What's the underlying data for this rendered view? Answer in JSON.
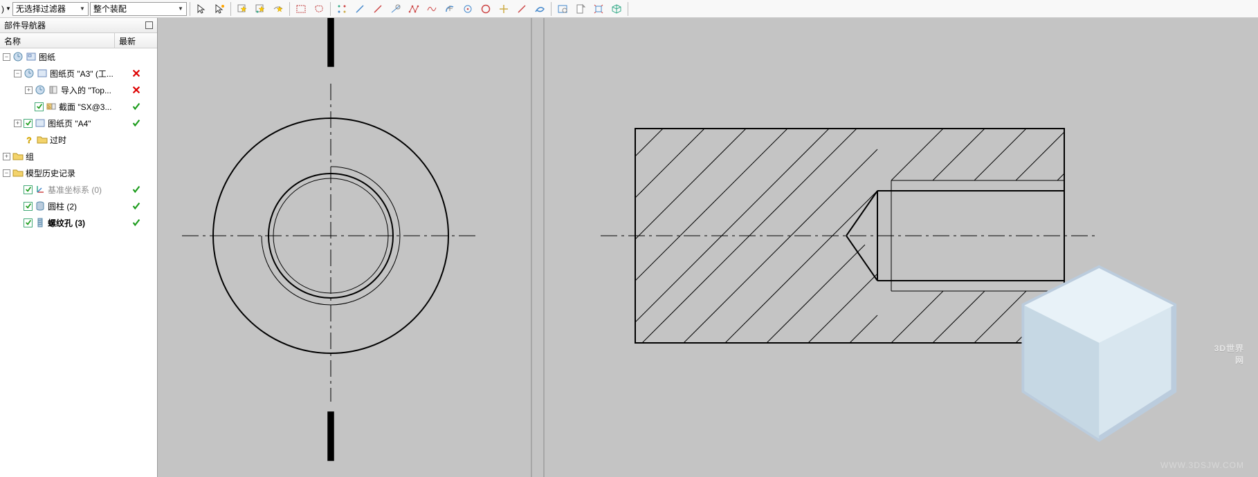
{
  "toolbar": {
    "truncated_menu": ")",
    "filter_label": "无选择过滤器",
    "assembly_label": "整个装配"
  },
  "panel": {
    "title": "部件导航器",
    "col_name": "名称",
    "col_latest": "最新"
  },
  "tree": {
    "drawing": "图纸",
    "sheet_a3": "图纸页 \"A3\" (工...",
    "imported_top": "导入的 \"Top...",
    "section_sx": "截面 \"SX@3...",
    "sheet_a4": "图纸页 \"A4\"",
    "obsolete": "过时",
    "group": "组",
    "model_history": "模型历史记录",
    "datum_csys": "基准坐标系 (0)",
    "cylinder": "圆柱 (2)",
    "threaded_hole": "螺纹孔 (3)"
  },
  "watermark": {
    "name": "3D世界网",
    "url": "WWW.3DSJW.COM"
  }
}
